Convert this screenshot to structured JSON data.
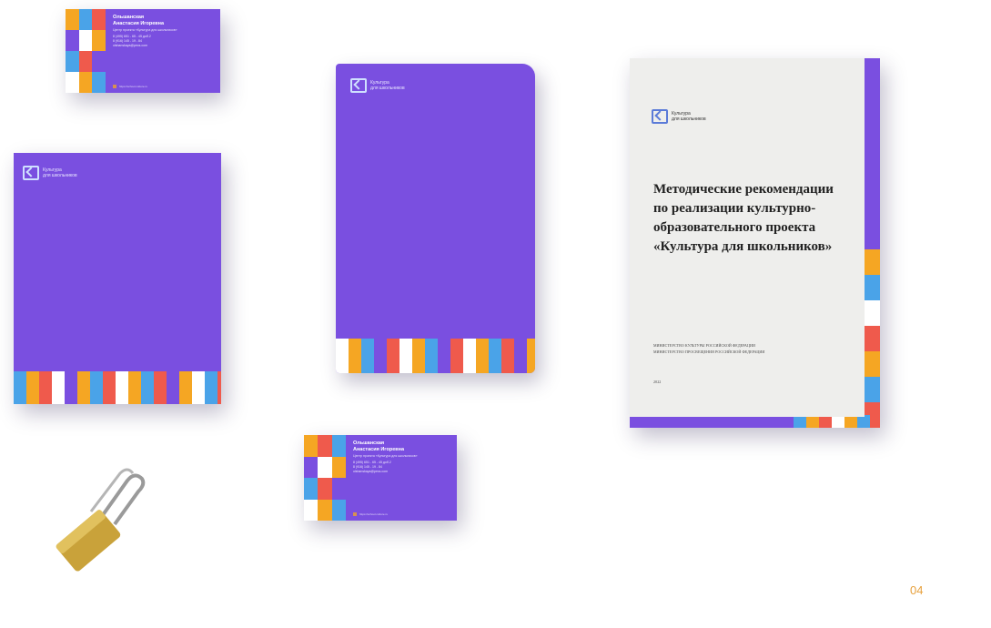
{
  "brand": {
    "logo_line1": "Культура",
    "logo_line2": "для школьников"
  },
  "card": {
    "name_line1": "Ольшанская",
    "name_line2": "Анастасия Игоревна",
    "role": "Центр проекта «Культура для школьников»",
    "phone": "8 (495) 651 - 65 - 45 доб.2",
    "email_line": "8 (916) 145 - 19 - 84",
    "site_line": "olshanskaya@pecs.com",
    "foot": "https://school.culture.ru"
  },
  "document": {
    "title_line1": "Методические рекомендации",
    "title_line2": "по реализации культурно-",
    "title_line3": "образовательного проекта",
    "title_line4": "«Культура для школьников»",
    "ministry1": "МИНИСТЕРСТВО КУЛЬТУРЫ РОССИЙСКОЙ ФЕДЕРАЦИИ",
    "ministry2": "МИНИСТЕРСТВО ПРОСВЕЩЕНИЯ РОССИЙСКОЙ ФЕДЕРАЦИИ",
    "year": "2022"
  },
  "page_number": "04",
  "colors": {
    "purple": "#7a4fe0",
    "accent_orange": "#f5a623",
    "accent_blue": "#4aa3e8",
    "accent_red": "#ef5a4c",
    "page_number": "#e7a03c"
  }
}
